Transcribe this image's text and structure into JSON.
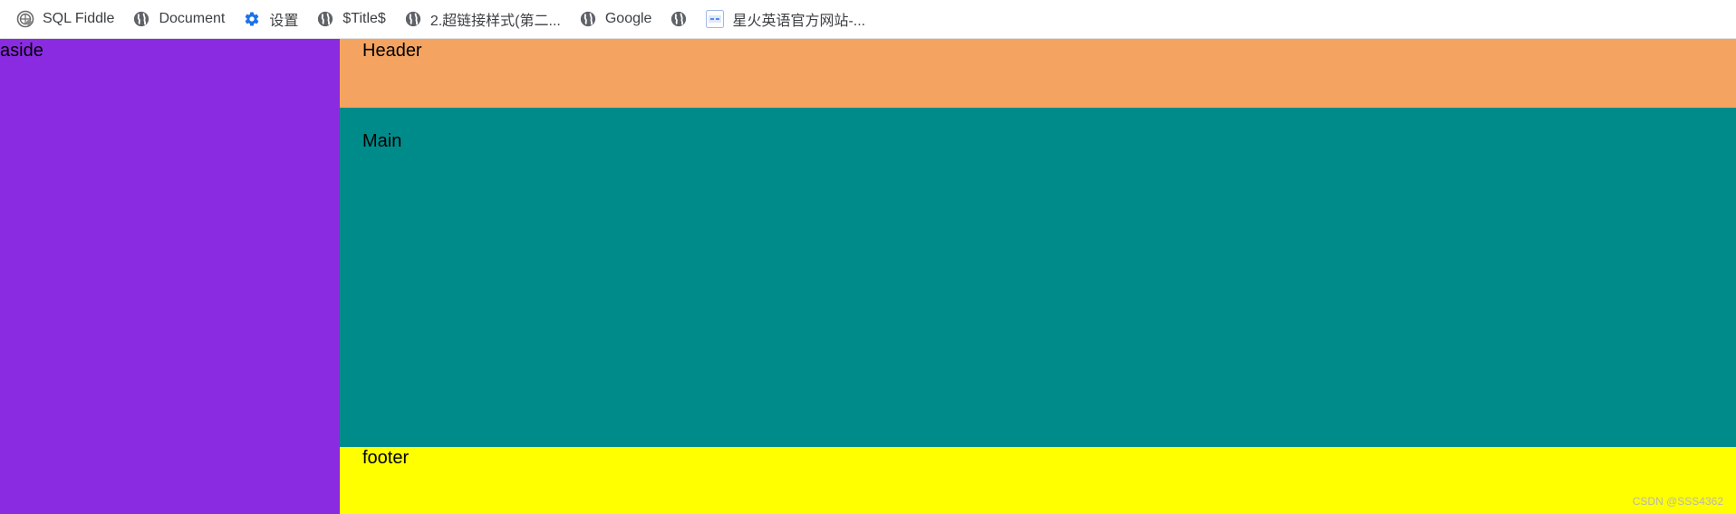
{
  "bookmarks": [
    {
      "label": "SQL Fiddle",
      "icon": "sql-fiddle-icon"
    },
    {
      "label": "Document",
      "icon": "globe-icon"
    },
    {
      "label": "设置",
      "icon": "gear-icon"
    },
    {
      "label": "$Title$",
      "icon": "globe-icon"
    },
    {
      "label": "2.超链接样式(第二...",
      "icon": "globe-icon"
    },
    {
      "label": "Google",
      "icon": "globe-icon"
    },
    {
      "label": "",
      "icon": "globe-icon"
    },
    {
      "label": "星火英语官方网站-...",
      "icon": "spark-english-icon"
    }
  ],
  "layout": {
    "aside": {
      "label": "aside",
      "color": "#8a2be2"
    },
    "header": {
      "label": "Header",
      "color": "#f4a460"
    },
    "main": {
      "label": "Main",
      "color": "#008b8b"
    },
    "footer": {
      "label": "footer",
      "color": "#ffff00"
    }
  },
  "watermark": "CSDN @SSS4362",
  "colors": {
    "gear": "#1a73e8",
    "globe": "#5f6368"
  }
}
